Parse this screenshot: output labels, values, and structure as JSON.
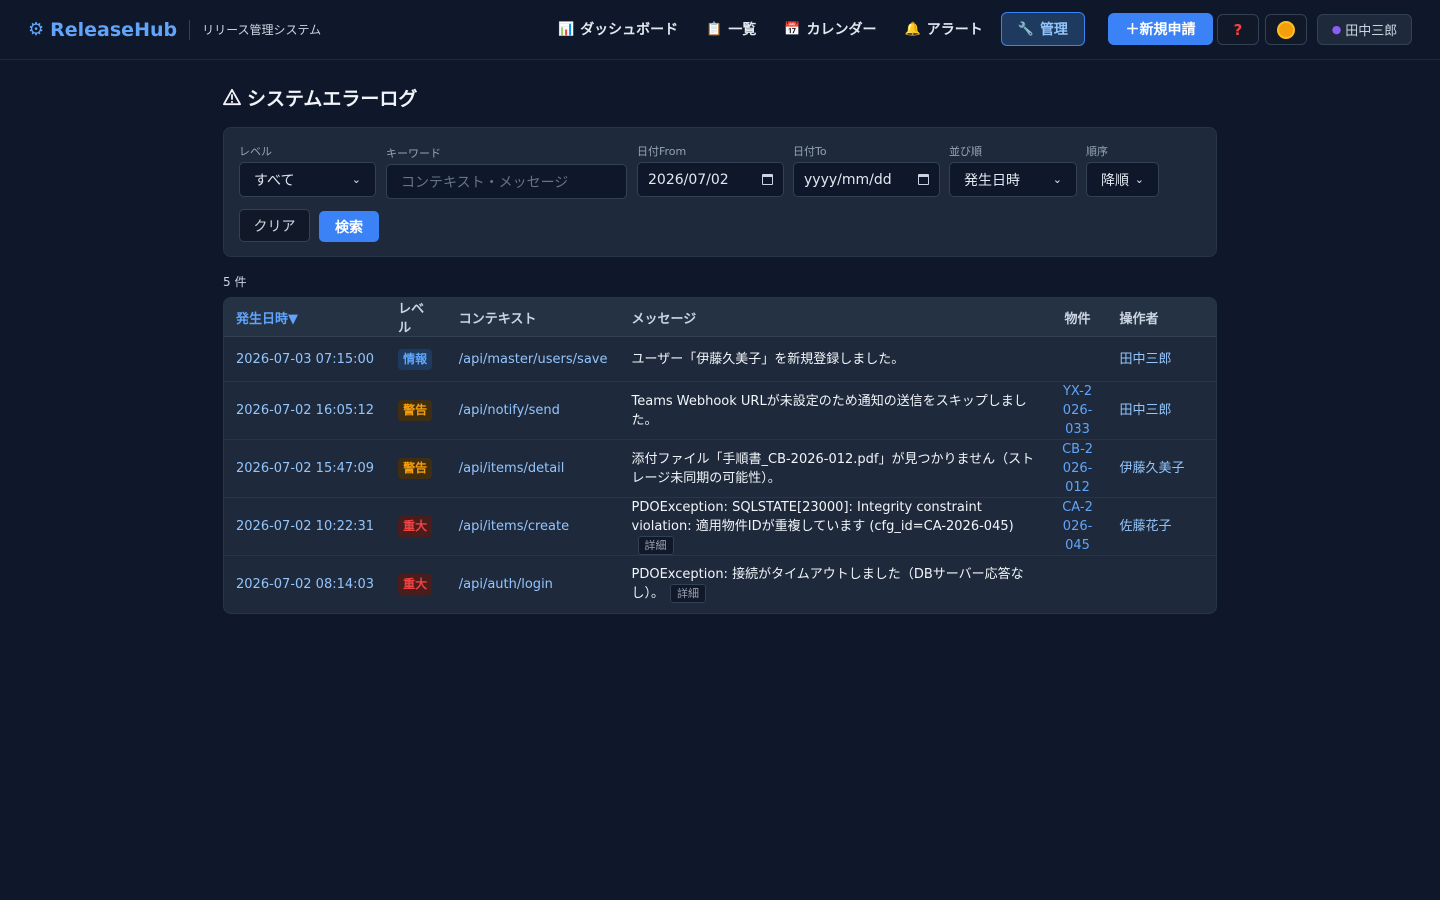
{
  "header": {
    "brand": "ReleaseHub",
    "subtitle": "リリース管理システム",
    "nav": [
      {
        "icon": "chart-icon",
        "glyph": "📊",
        "label": "ダッシュボード"
      },
      {
        "icon": "clipboard-icon",
        "glyph": "📋",
        "label": "一覧"
      },
      {
        "icon": "calendar-icon",
        "glyph": "📅",
        "label": "カレンダー"
      },
      {
        "icon": "bell-icon",
        "glyph": "🔔",
        "label": "アラート"
      },
      {
        "icon": "wrench-icon",
        "glyph": "🔧",
        "label": "管理"
      }
    ],
    "new_button": "＋新規申請",
    "help_glyph": "?",
    "user_name": "田中三郎"
  },
  "page": {
    "title": "システムエラーログ"
  },
  "filters": {
    "level": {
      "label": "レベル",
      "value": "すべて"
    },
    "keyword": {
      "label": "キーワード",
      "placeholder": "コンテキスト・メッセージ"
    },
    "date_from": {
      "label": "日付From",
      "value": "2026/07/02"
    },
    "date_to": {
      "label": "日付To",
      "value": "yyyy/mm/dd"
    },
    "sort": {
      "label": "並び順",
      "value": "発生日時"
    },
    "order": {
      "label": "順序",
      "value": "降順"
    },
    "clear_label": "クリア",
    "search_label": "検索"
  },
  "result_count": "5 件",
  "table": {
    "headers": {
      "date": "発生日時▼",
      "level": "レベル",
      "context": "コンテキスト",
      "message": "メッセージ",
      "item": "物件",
      "user": "操作者"
    },
    "detail_label": "詳細",
    "rows": [
      {
        "date": "2026-07-03 07:15:00",
        "level": "情報",
        "level_type": "info",
        "context": "/api/master/users/save",
        "message": "ユーザー「伊藤久美子」を新規登録しました。",
        "item": "",
        "user": "田中三郎",
        "detail": false
      },
      {
        "date": "2026-07-02 16:05:12",
        "level": "警告",
        "level_type": "warn",
        "context": "/api/notify/send",
        "message": "Teams Webhook URLが未設定のため通知の送信をスキップしました。",
        "item": "YX-2026-033",
        "user": "田中三郎",
        "detail": false
      },
      {
        "date": "2026-07-02 15:47:09",
        "level": "警告",
        "level_type": "warn",
        "context": "/api/items/detail",
        "message": "添付ファイル「手順書_CB-2026-012.pdf」が見つかりません（ストレージ未同期の可能性）。",
        "item": "CB-2026-012",
        "user": "伊藤久美子",
        "detail": false
      },
      {
        "date": "2026-07-02 10:22:31",
        "level": "重大",
        "level_type": "crit",
        "context": "/api/items/create",
        "message": "PDOException: SQLSTATE[23000]: Integrity constraint violation: 適用物件IDが重複しています (cfg_id=CA-2026-045)",
        "item": "CA-2026-045",
        "user": "佐藤花子",
        "detail": true
      },
      {
        "date": "2026-07-02 08:14:03",
        "level": "重大",
        "level_type": "crit",
        "context": "/api/auth/login",
        "message": "PDOException: 接続がタイムアウトしました（DBサーバー応答なし）。",
        "item": "",
        "user": "",
        "detail": true
      }
    ]
  }
}
